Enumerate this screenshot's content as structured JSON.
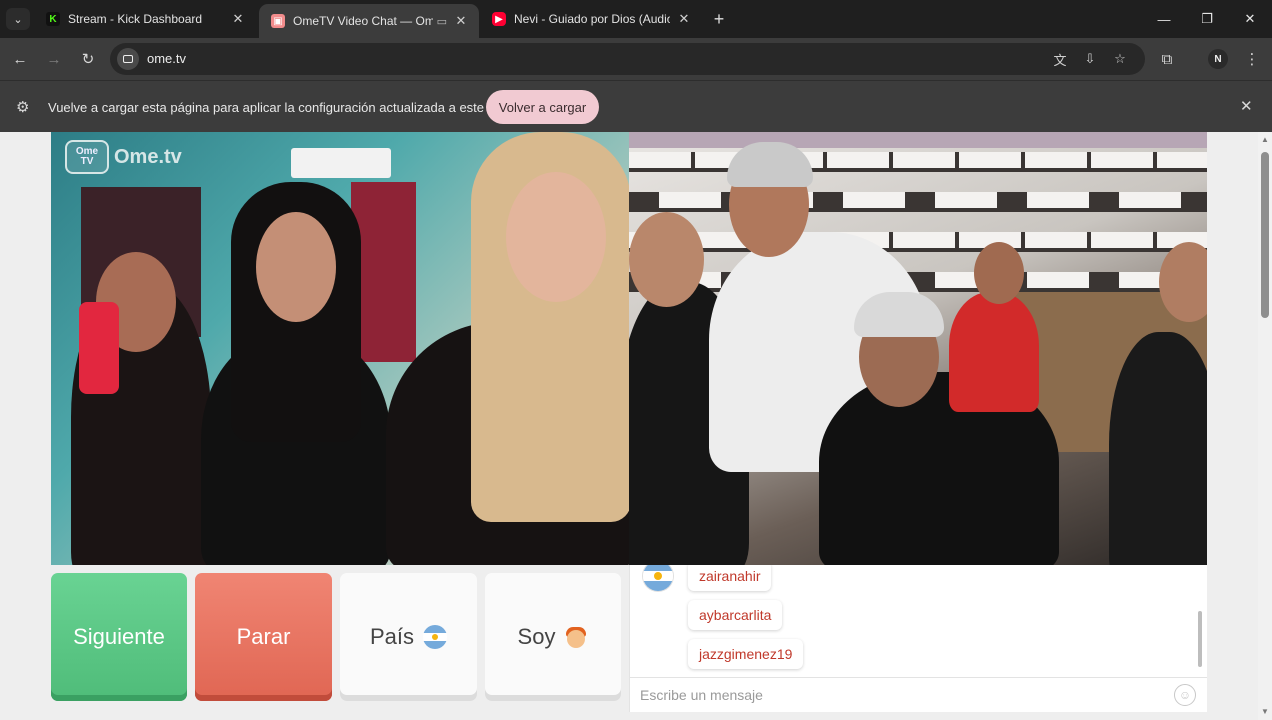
{
  "browser": {
    "tabs": [
      {
        "title": "Stream - Kick Dashboard",
        "favicon": "kick-icon",
        "active": false
      },
      {
        "title": "OmeTV Video Chat — Ome",
        "favicon": "ometv-icon",
        "active": true
      },
      {
        "title": "Nevi - Guiado por Dios (Audio",
        "favicon": "youtube-icon",
        "active": false
      }
    ],
    "url": "ome.tv",
    "profile_initial": "N",
    "infobar": {
      "message": "Vuelve a cargar esta página para aplicar la configuración actualizada a este sitio",
      "button_label": "Volver a cargar"
    }
  },
  "page": {
    "logo": {
      "badge_top": "Ome",
      "badge_bottom": "TV",
      "text": "Ome.tv"
    },
    "controls": {
      "next_label": "Siguiente",
      "stop_label": "Parar",
      "country_label": "País",
      "gender_label": "Soy"
    },
    "chat": {
      "messages": [
        "zairanahir",
        "aybarcarlita",
        "jazzgimenez19"
      ],
      "input_placeholder": "Escribe un mensaje"
    }
  },
  "colors": {
    "next_button": "#5cc886",
    "stop_button": "#e8715f",
    "chat_username": "#c0392b",
    "infobar_button": "#f1cad2"
  }
}
